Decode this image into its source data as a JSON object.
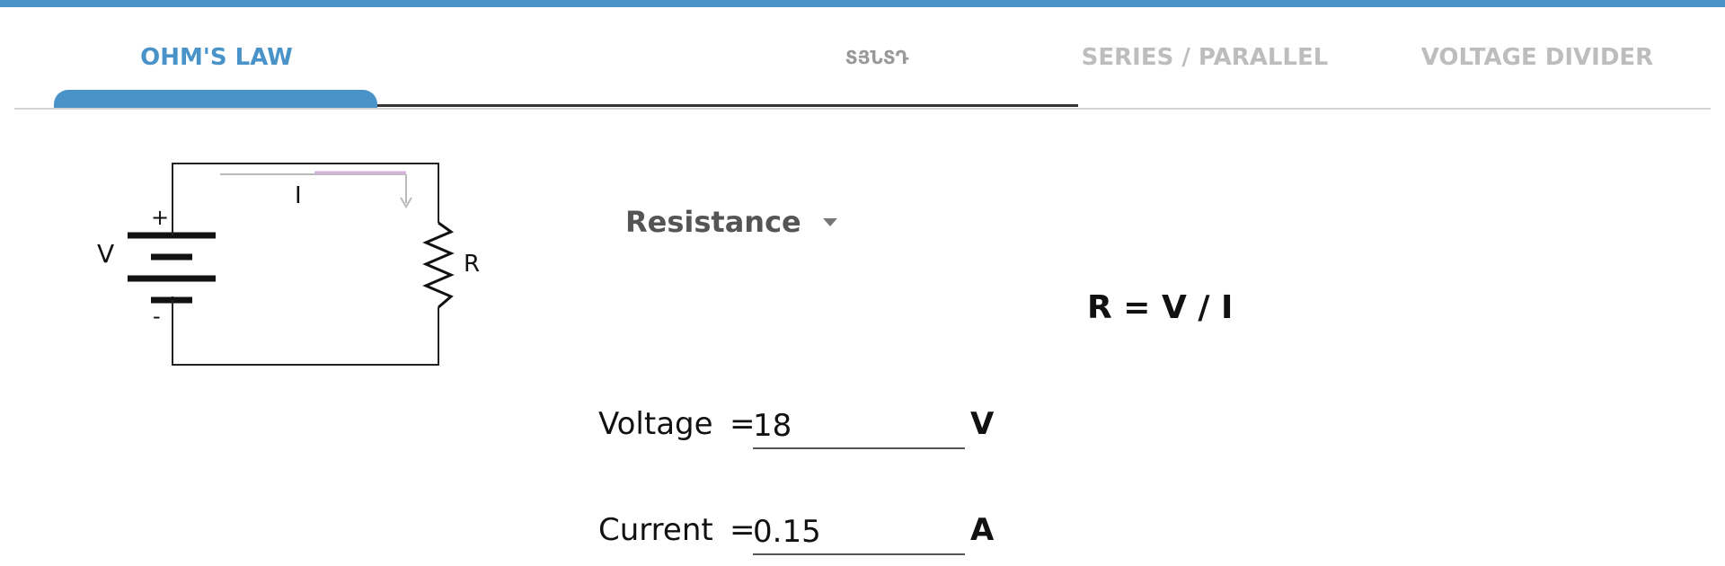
{
  "header": {
    "accent_color": "#4a93c9"
  },
  "tabs": [
    {
      "label": "OHM'S LAW",
      "active": true
    },
    {
      "label": "ՏՅՆՏԴ",
      "active": false
    },
    {
      "label": "SERIES / PARALLEL",
      "active": false
    },
    {
      "label": "VOLTAGE DIVIDER",
      "active": false
    }
  ],
  "circuit": {
    "voltage_label": "V",
    "plus_label": "+",
    "minus_label": "-",
    "current_label": "I",
    "resistor_label": "R"
  },
  "solve_for": {
    "selected": "Resistance"
  },
  "formula": "R = V / I",
  "fields": [
    {
      "label": "Voltage",
      "equals": "=",
      "value": "18",
      "unit": "V"
    },
    {
      "label": "Current",
      "equals": "=",
      "value": "0.15",
      "unit": "A"
    }
  ]
}
